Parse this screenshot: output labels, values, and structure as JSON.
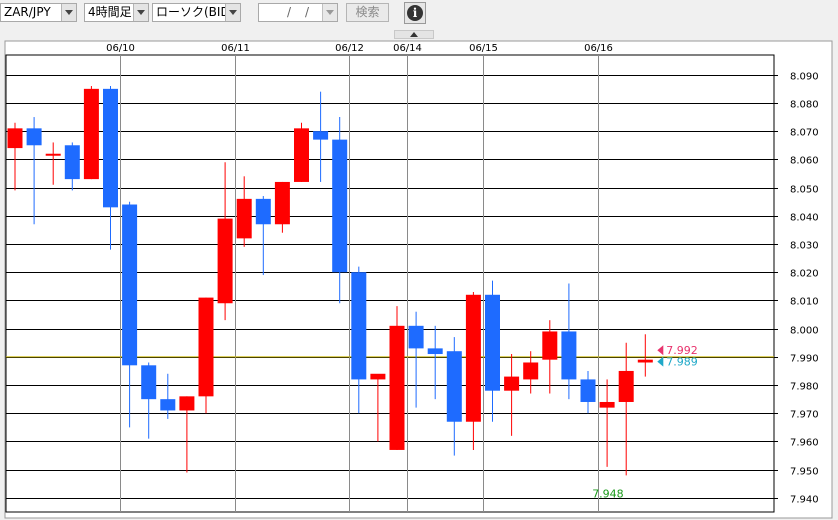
{
  "toolbar": {
    "pair": "ZAR/JPY",
    "timeframe": "4時間足",
    "chart_kind": "ローソク(BID)",
    "date_sep1": "/",
    "date_sep2": "/",
    "search_label": "検索",
    "info_icon": "i"
  },
  "colors": {
    "up": "#ff0000",
    "down": "#1e6bff",
    "grid": "#000000",
    "price_line": "#c8b400",
    "bid_label": "#e8336d",
    "ask_label": "#1fa8c8",
    "low_label": "#1a9a1a"
  },
  "chart_data": {
    "type": "candlestick",
    "ylim": [
      7.935,
      8.097
    ],
    "y_ticks": [
      "8.090",
      "8.080",
      "8.070",
      "8.060",
      "8.050",
      "8.040",
      "8.030",
      "8.020",
      "8.010",
      "8.000",
      "7.990",
      "7.980",
      "7.970",
      "7.960",
      "7.950",
      "7.940"
    ],
    "date_labels": [
      {
        "label": "06/10",
        "index": 5.5
      },
      {
        "label": "06/11",
        "index": 11.5
      },
      {
        "label": "06/12",
        "index": 17.5
      },
      {
        "label": "06/14",
        "index": 20.5
      },
      {
        "label": "06/15",
        "index": 24.5
      },
      {
        "label": "06/16",
        "index": 30.5
      }
    ],
    "candles": [
      {
        "o": 8.064,
        "h": 8.073,
        "l": 8.049,
        "c": 8.071
      },
      {
        "o": 8.071,
        "h": 8.075,
        "l": 8.037,
        "c": 8.065
      },
      {
        "o": 8.062,
        "h": 8.066,
        "l": 8.051,
        "c": 8.062
      },
      {
        "o": 8.065,
        "h": 8.066,
        "l": 8.049,
        "c": 8.053
      },
      {
        "o": 8.053,
        "h": 8.086,
        "l": 8.053,
        "c": 8.085
      },
      {
        "o": 8.085,
        "h": 8.086,
        "l": 8.028,
        "c": 8.043
      },
      {
        "o": 8.044,
        "h": 8.045,
        "l": 7.965,
        "c": 7.987
      },
      {
        "o": 7.987,
        "h": 7.988,
        "l": 7.961,
        "c": 7.975
      },
      {
        "o": 7.975,
        "h": 7.984,
        "l": 7.968,
        "c": 7.971
      },
      {
        "o": 7.971,
        "h": 7.976,
        "l": 7.949,
        "c": 7.976
      },
      {
        "o": 7.976,
        "h": 8.011,
        "l": 7.97,
        "c": 8.011
      },
      {
        "o": 8.009,
        "h": 8.059,
        "l": 8.003,
        "c": 8.039
      },
      {
        "o": 8.032,
        "h": 8.054,
        "l": 8.029,
        "c": 8.046
      },
      {
        "o": 8.046,
        "h": 8.047,
        "l": 8.019,
        "c": 8.037
      },
      {
        "o": 8.037,
        "h": 8.052,
        "l": 8.034,
        "c": 8.052
      },
      {
        "o": 8.052,
        "h": 8.073,
        "l": 8.052,
        "c": 8.071
      },
      {
        "o": 8.07,
        "h": 8.084,
        "l": 8.052,
        "c": 8.067
      },
      {
        "o": 8.067,
        "h": 8.075,
        "l": 8.009,
        "c": 8.02
      },
      {
        "o": 8.02,
        "h": 8.022,
        "l": 7.97,
        "c": 7.982
      },
      {
        "o": 7.982,
        "h": 7.983,
        "l": 7.96,
        "c": 7.984
      },
      {
        "o": 7.957,
        "h": 8.008,
        "l": 7.957,
        "c": 8.001
      },
      {
        "o": 8.001,
        "h": 8.006,
        "l": 7.972,
        "c": 7.993
      },
      {
        "o": 7.993,
        "h": 8.001,
        "l": 7.975,
        "c": 7.991
      },
      {
        "o": 7.992,
        "h": 7.997,
        "l": 7.955,
        "c": 7.967
      },
      {
        "o": 7.967,
        "h": 8.013,
        "l": 7.957,
        "c": 8.012
      },
      {
        "o": 8.012,
        "h": 8.017,
        "l": 7.967,
        "c": 7.978
      },
      {
        "o": 7.978,
        "h": 7.991,
        "l": 7.962,
        "c": 7.983
      },
      {
        "o": 7.982,
        "h": 7.992,
        "l": 7.977,
        "c": 7.988
      },
      {
        "o": 7.989,
        "h": 8.003,
        "l": 7.977,
        "c": 7.999
      },
      {
        "o": 7.999,
        "h": 8.016,
        "l": 7.975,
        "c": 7.982
      },
      {
        "o": 7.982,
        "h": 7.985,
        "l": 7.97,
        "c": 7.974
      },
      {
        "o": 7.972,
        "h": 7.982,
        "l": 7.951,
        "c": 7.974
      },
      {
        "o": 7.974,
        "h": 7.995,
        "l": 7.948,
        "c": 7.985
      },
      {
        "o": 7.988,
        "h": 7.998,
        "l": 7.983,
        "c": 7.989
      }
    ],
    "current_line": 7.99,
    "bid": {
      "value": 7.992,
      "label": "7.992"
    },
    "ask": {
      "value": 7.989,
      "label": "7.989"
    },
    "low_annotation": {
      "index": 32,
      "value": 7.948,
      "label": "7.948"
    }
  }
}
